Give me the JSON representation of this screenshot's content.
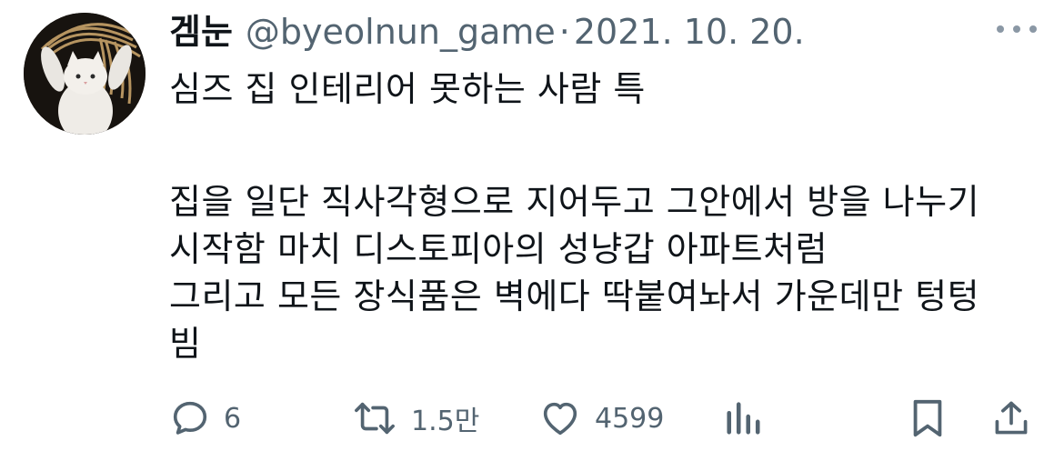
{
  "author": {
    "display_name": "겜눈",
    "handle": "@byeolnun_game",
    "separator": "·",
    "date": "2021. 10. 20."
  },
  "tweet": {
    "line1": "심즈 집 인테리어 못하는 사람 특",
    "line2": "집을 일단 직사각형으로 지어두고 그안에서 방을 나누기",
    "line3": "시작함 마치 디스토피아의 성냥갑 아파트처럼",
    "line4": "그리고 모든 장식품은 벽에다 딱붙여놔서 가운데만 텅텅",
    "line5": "빔"
  },
  "actions": {
    "reply_count": "6",
    "retweet_count": "1.5만",
    "like_count": "4599"
  },
  "icons": {
    "avatar": "cat-holding-straw-avatar",
    "more": "more-dots-icon",
    "reply": "reply-icon",
    "retweet": "retweet-icon",
    "like": "heart-icon",
    "views": "bar-chart-icon",
    "bookmark": "bookmark-icon",
    "share": "share-icon"
  },
  "colors": {
    "text": "#0f1419",
    "muted": "#536471"
  }
}
